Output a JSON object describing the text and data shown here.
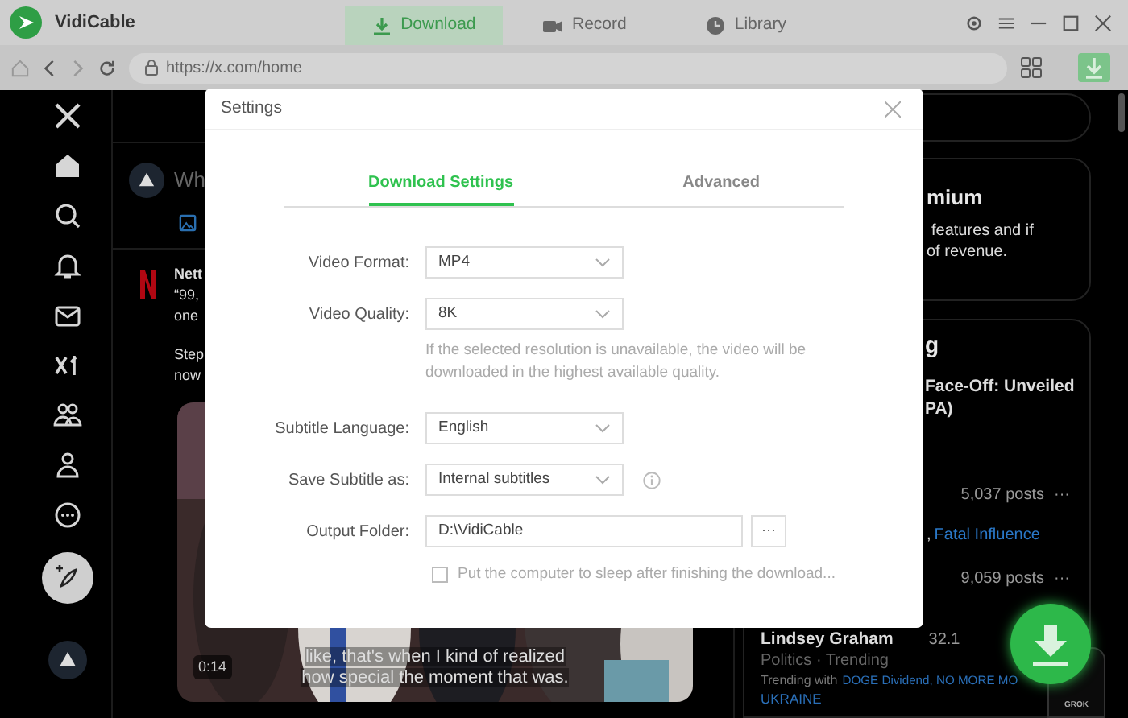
{
  "app": {
    "name": "VidiCable"
  },
  "main_tabs": [
    {
      "label": "Download",
      "selected": true
    },
    {
      "label": "Record",
      "selected": false
    },
    {
      "label": "Library",
      "selected": false
    }
  ],
  "address_bar": {
    "url": "https://x.com/home"
  },
  "background_page": {
    "compose_placeholder": "Wh",
    "post": {
      "author": "Nett",
      "lines": [
        "“99,",
        "one"
      ],
      "lines2": [
        "Step",
        "now"
      ],
      "video": {
        "duration": "0:14",
        "caption": [
          "like, that's when I kind of realized",
          "how special the moment that was."
        ]
      }
    },
    "premium": {
      "title": "mium",
      "lines": [
        "features and if",
        "of revenue."
      ]
    },
    "trends": {
      "title": "g",
      "headline": [
        "Face-Off: Unveiled",
        "PA)"
      ],
      "rows": [
        {
          "posts": "5,037 posts",
          "more": "···",
          "related_prefix": ",",
          "related_link": "Fatal Influence"
        },
        {
          "posts": "9,059 posts",
          "more": "···"
        }
      ],
      "last": {
        "name": "Lindsey Graham",
        "count": "32.1",
        "category": "Politics · Trending",
        "prefix": "Trending with",
        "links": "DOGE Dividend, NO MORE MO",
        "links2": "UKRAINE"
      }
    },
    "grok": "GROK"
  },
  "dialog": {
    "title": "Settings",
    "tabs": [
      {
        "label": "Download Settings",
        "selected": true
      },
      {
        "label": "Advanced",
        "selected": false
      }
    ],
    "fields": [
      {
        "kind": "select",
        "label": "Video Format:",
        "value": "MP4"
      },
      {
        "kind": "select",
        "label": "Video Quality:",
        "value": "8K",
        "hint": "If the selected resolution is unavailable, the video will be downloaded in the highest available quality."
      },
      {
        "kind": "select",
        "label": "Subtitle Language:",
        "value": "English"
      },
      {
        "kind": "select",
        "label": "Save Subtitle as:",
        "value": "Internal subtitles",
        "info": true
      },
      {
        "kind": "folder",
        "label": "Output Folder:",
        "value": "D:\\VidiCable",
        "browse": "···"
      }
    ],
    "sleep_option": {
      "label": "Put the computer to sleep after finishing the download...",
      "checked": false
    }
  }
}
